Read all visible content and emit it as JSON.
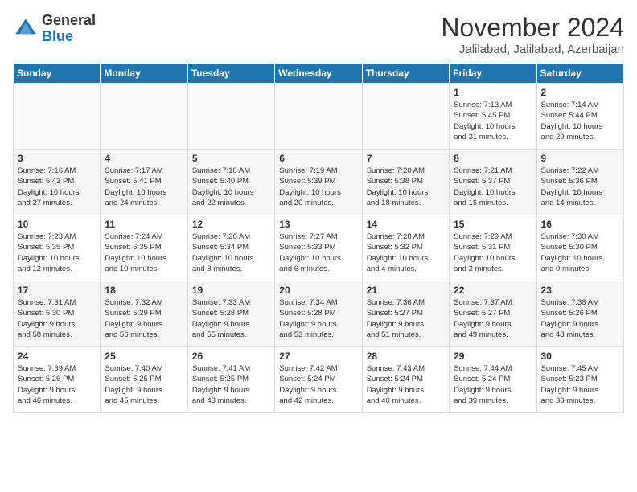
{
  "header": {
    "logo_line1": "General",
    "logo_line2": "Blue",
    "month": "November 2024",
    "location": "Jalilabad, Jalilabad, Azerbaijan"
  },
  "weekdays": [
    "Sunday",
    "Monday",
    "Tuesday",
    "Wednesday",
    "Thursday",
    "Friday",
    "Saturday"
  ],
  "weeks": [
    [
      {
        "day": "",
        "info": ""
      },
      {
        "day": "",
        "info": ""
      },
      {
        "day": "",
        "info": ""
      },
      {
        "day": "",
        "info": ""
      },
      {
        "day": "",
        "info": ""
      },
      {
        "day": "1",
        "info": "Sunrise: 7:13 AM\nSunset: 5:45 PM\nDaylight: 10 hours\nand 31 minutes."
      },
      {
        "day": "2",
        "info": "Sunrise: 7:14 AM\nSunset: 5:44 PM\nDaylight: 10 hours\nand 29 minutes."
      }
    ],
    [
      {
        "day": "3",
        "info": "Sunrise: 7:16 AM\nSunset: 5:43 PM\nDaylight: 10 hours\nand 27 minutes."
      },
      {
        "day": "4",
        "info": "Sunrise: 7:17 AM\nSunset: 5:41 PM\nDaylight: 10 hours\nand 24 minutes."
      },
      {
        "day": "5",
        "info": "Sunrise: 7:18 AM\nSunset: 5:40 PM\nDaylight: 10 hours\nand 22 minutes."
      },
      {
        "day": "6",
        "info": "Sunrise: 7:19 AM\nSunset: 5:39 PM\nDaylight: 10 hours\nand 20 minutes."
      },
      {
        "day": "7",
        "info": "Sunrise: 7:20 AM\nSunset: 5:38 PM\nDaylight: 10 hours\nand 18 minutes."
      },
      {
        "day": "8",
        "info": "Sunrise: 7:21 AM\nSunset: 5:37 PM\nDaylight: 10 hours\nand 16 minutes."
      },
      {
        "day": "9",
        "info": "Sunrise: 7:22 AM\nSunset: 5:36 PM\nDaylight: 10 hours\nand 14 minutes."
      }
    ],
    [
      {
        "day": "10",
        "info": "Sunrise: 7:23 AM\nSunset: 5:35 PM\nDaylight: 10 hours\nand 12 minutes."
      },
      {
        "day": "11",
        "info": "Sunrise: 7:24 AM\nSunset: 5:35 PM\nDaylight: 10 hours\nand 10 minutes."
      },
      {
        "day": "12",
        "info": "Sunrise: 7:26 AM\nSunset: 5:34 PM\nDaylight: 10 hours\nand 8 minutes."
      },
      {
        "day": "13",
        "info": "Sunrise: 7:27 AM\nSunset: 5:33 PM\nDaylight: 10 hours\nand 6 minutes."
      },
      {
        "day": "14",
        "info": "Sunrise: 7:28 AM\nSunset: 5:32 PM\nDaylight: 10 hours\nand 4 minutes."
      },
      {
        "day": "15",
        "info": "Sunrise: 7:29 AM\nSunset: 5:31 PM\nDaylight: 10 hours\nand 2 minutes."
      },
      {
        "day": "16",
        "info": "Sunrise: 7:30 AM\nSunset: 5:30 PM\nDaylight: 10 hours\nand 0 minutes."
      }
    ],
    [
      {
        "day": "17",
        "info": "Sunrise: 7:31 AM\nSunset: 5:30 PM\nDaylight: 9 hours\nand 58 minutes."
      },
      {
        "day": "18",
        "info": "Sunrise: 7:32 AM\nSunset: 5:29 PM\nDaylight: 9 hours\nand 56 minutes."
      },
      {
        "day": "19",
        "info": "Sunrise: 7:33 AM\nSunset: 5:28 PM\nDaylight: 9 hours\nand 55 minutes."
      },
      {
        "day": "20",
        "info": "Sunrise: 7:34 AM\nSunset: 5:28 PM\nDaylight: 9 hours\nand 53 minutes."
      },
      {
        "day": "21",
        "info": "Sunrise: 7:36 AM\nSunset: 5:27 PM\nDaylight: 9 hours\nand 51 minutes."
      },
      {
        "day": "22",
        "info": "Sunrise: 7:37 AM\nSunset: 5:27 PM\nDaylight: 9 hours\nand 49 minutes."
      },
      {
        "day": "23",
        "info": "Sunrise: 7:38 AM\nSunset: 5:26 PM\nDaylight: 9 hours\nand 48 minutes."
      }
    ],
    [
      {
        "day": "24",
        "info": "Sunrise: 7:39 AM\nSunset: 5:26 PM\nDaylight: 9 hours\nand 46 minutes."
      },
      {
        "day": "25",
        "info": "Sunrise: 7:40 AM\nSunset: 5:25 PM\nDaylight: 9 hours\nand 45 minutes."
      },
      {
        "day": "26",
        "info": "Sunrise: 7:41 AM\nSunset: 5:25 PM\nDaylight: 9 hours\nand 43 minutes."
      },
      {
        "day": "27",
        "info": "Sunrise: 7:42 AM\nSunset: 5:24 PM\nDaylight: 9 hours\nand 42 minutes."
      },
      {
        "day": "28",
        "info": "Sunrise: 7:43 AM\nSunset: 5:24 PM\nDaylight: 9 hours\nand 40 minutes."
      },
      {
        "day": "29",
        "info": "Sunrise: 7:44 AM\nSunset: 5:24 PM\nDaylight: 9 hours\nand 39 minutes."
      },
      {
        "day": "30",
        "info": "Sunrise: 7:45 AM\nSunset: 5:23 PM\nDaylight: 9 hours\nand 38 minutes."
      }
    ]
  ]
}
